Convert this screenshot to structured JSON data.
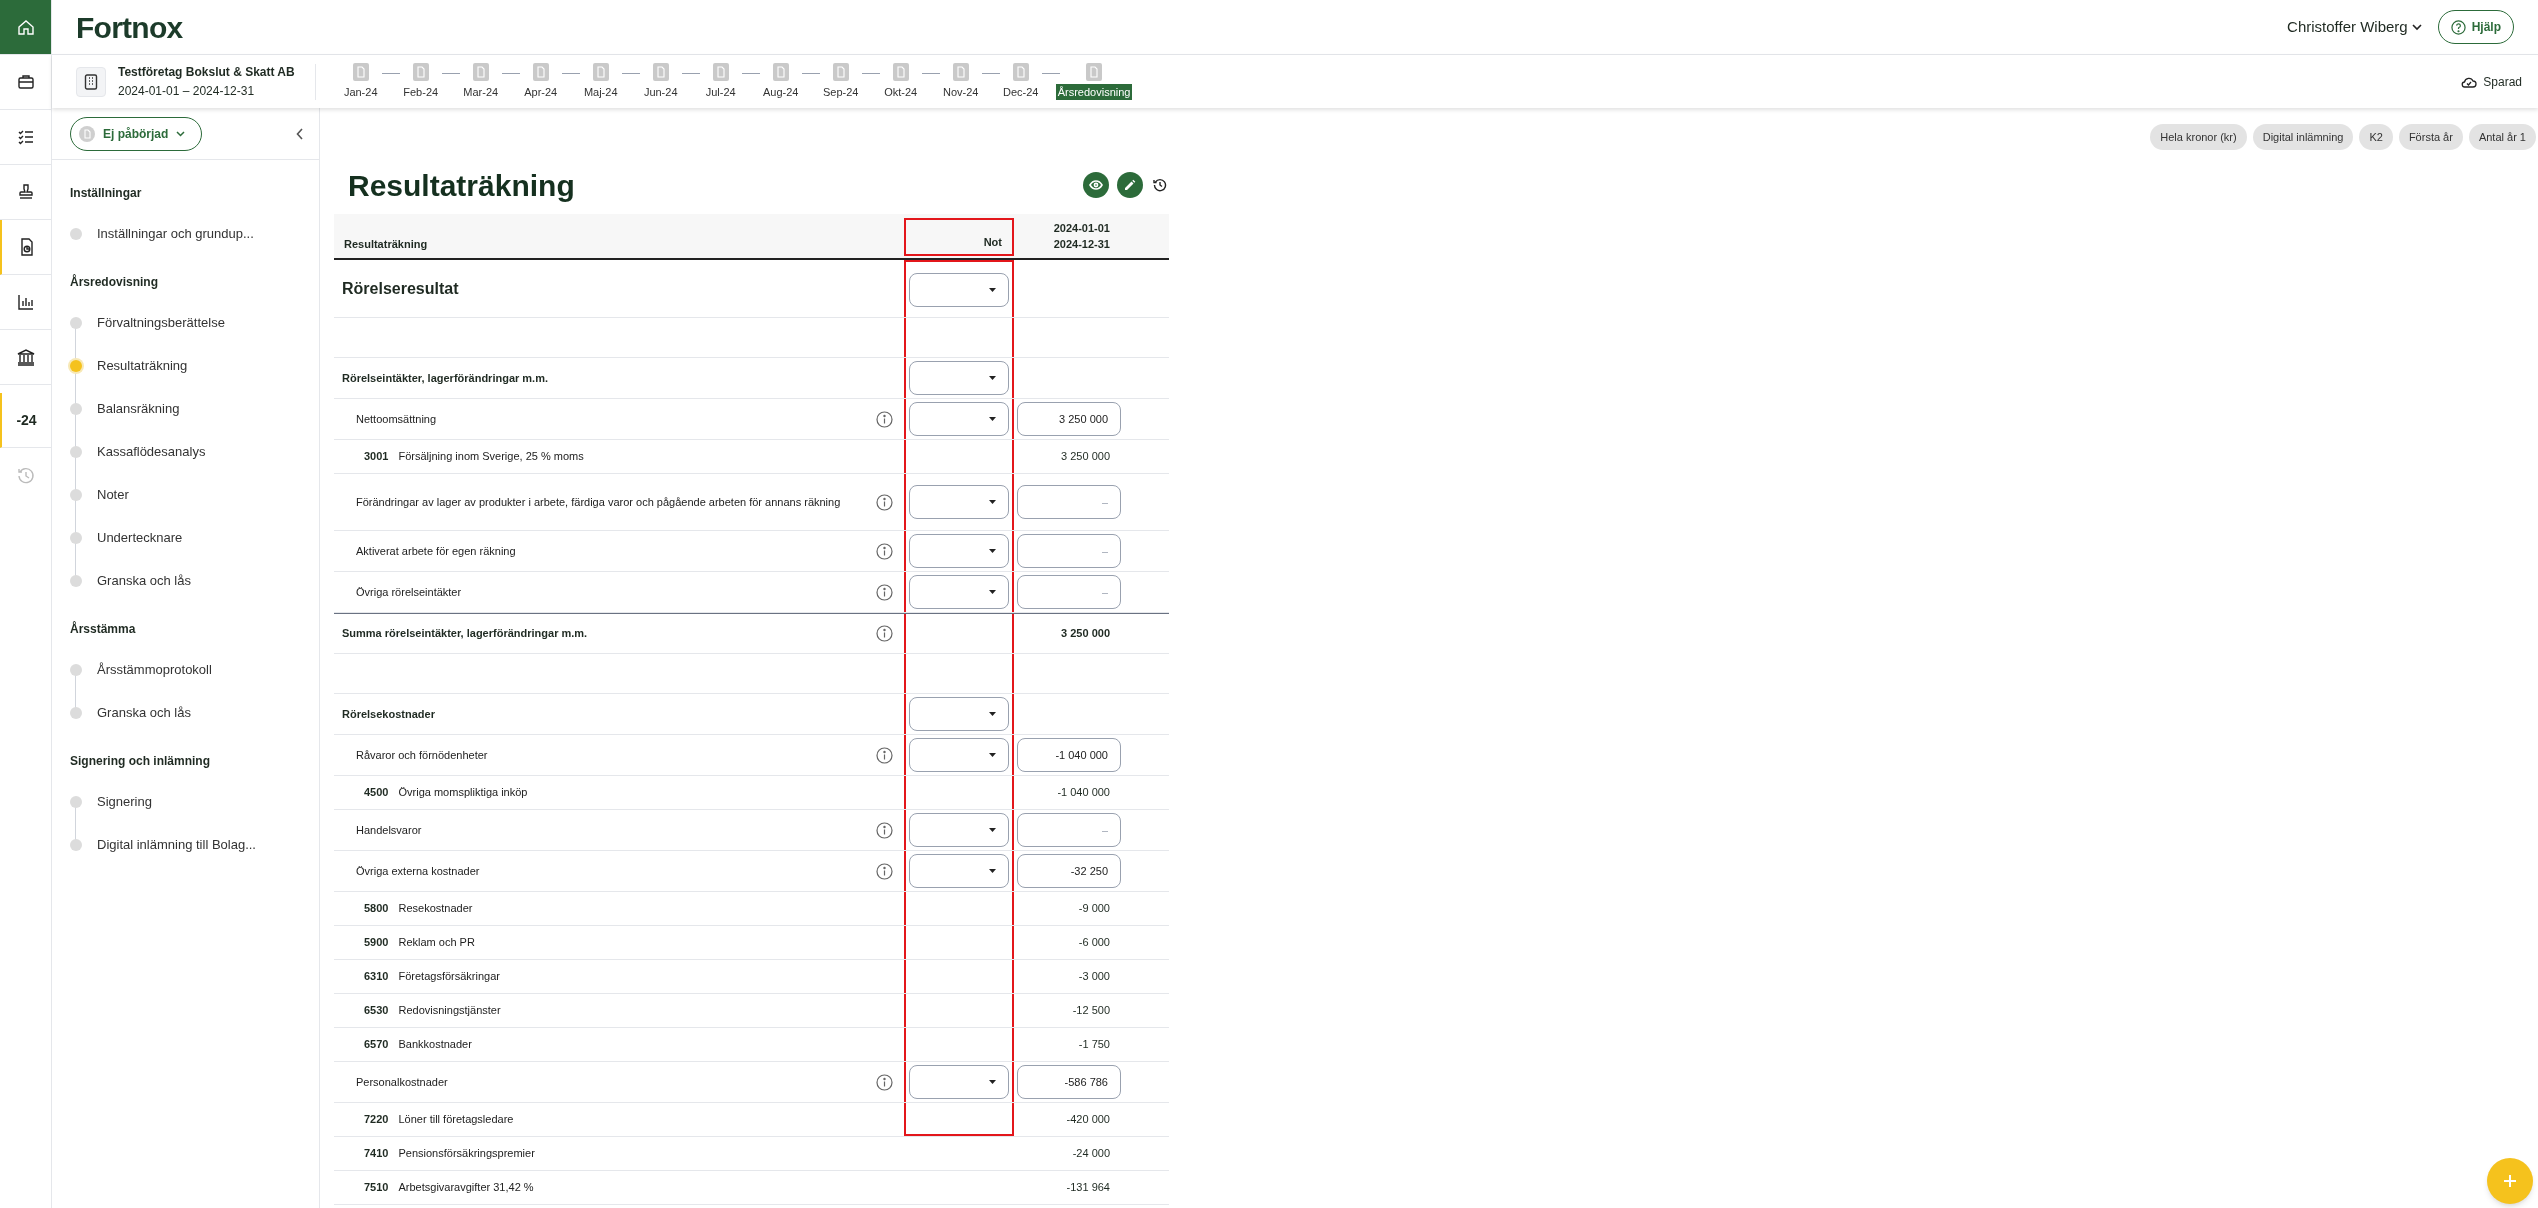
{
  "app": {
    "logo": "Fortnox",
    "user": "Christoffer Wiberg",
    "help_button": "Hjälp"
  },
  "rail": [
    {
      "kind": "home",
      "selected": true,
      "flagged": false
    },
    {
      "kind": "briefcase",
      "selected": false,
      "flagged": false
    },
    {
      "kind": "checklist",
      "selected": false,
      "flagged": false
    },
    {
      "kind": "stamp",
      "selected": false,
      "flagged": false
    },
    {
      "kind": "document",
      "selected": false,
      "flagged": true
    },
    {
      "kind": "chart",
      "selected": false,
      "flagged": false
    },
    {
      "kind": "bank",
      "selected": false,
      "flagged": false
    },
    {
      "kind": "text",
      "label": "-24",
      "selected": false,
      "flagged": true
    },
    {
      "kind": "history",
      "selected": false,
      "flagged": false
    }
  ],
  "company": {
    "name": "Testföretag Bokslut & Skatt AB",
    "period": "2024-01-01 – 2024-12-31"
  },
  "timeline": [
    {
      "label": "Jan-24",
      "selected": false
    },
    {
      "label": "Feb-24",
      "selected": false
    },
    {
      "label": "Mar-24",
      "selected": false
    },
    {
      "label": "Apr-24",
      "selected": false
    },
    {
      "label": "Maj-24",
      "selected": false
    },
    {
      "label": "Jun-24",
      "selected": false
    },
    {
      "label": "Jul-24",
      "selected": false
    },
    {
      "label": "Aug-24",
      "selected": false
    },
    {
      "label": "Sep-24",
      "selected": false
    },
    {
      "label": "Okt-24",
      "selected": false
    },
    {
      "label": "Nov-24",
      "selected": false
    },
    {
      "label": "Dec-24",
      "selected": false
    },
    {
      "label": "Årsredovisning",
      "selected": true
    }
  ],
  "save_status": "Sparad",
  "sidebar": {
    "status_button": "Ej påbörjad",
    "sections": [
      {
        "title": "Inställningar",
        "items": [
          {
            "label": "Inställningar och grundup...",
            "selected": false
          }
        ]
      },
      {
        "title": "Årsredovisning",
        "items": [
          {
            "label": "Förvaltningsberättelse",
            "selected": false
          },
          {
            "label": "Resultaträkning",
            "selected": true
          },
          {
            "label": "Balansräkning",
            "selected": false
          },
          {
            "label": "Kassaflödesanalys",
            "selected": false
          },
          {
            "label": "Noter",
            "selected": false
          },
          {
            "label": "Undertecknare",
            "selected": false
          },
          {
            "label": "Granska och lås",
            "selected": false
          }
        ]
      },
      {
        "title": "Årsstämma",
        "items": [
          {
            "label": "Årsstämmoprotokoll",
            "selected": false
          },
          {
            "label": "Granska och lås",
            "selected": false
          }
        ]
      },
      {
        "title": "Signering och inlämning",
        "items": [
          {
            "label": "Signering",
            "selected": false
          },
          {
            "label": "Digital inlämning till Bolag...",
            "selected": false
          }
        ]
      }
    ]
  },
  "chips": [
    "Hela kronor (kr)",
    "Digital inlämning",
    "K2",
    "Första år",
    "Antal år 1"
  ],
  "page_title": "Resultaträkning",
  "table": {
    "header": {
      "label": "Resultaträkning",
      "note": "Not",
      "note_highlighted": true,
      "period_start": "2024-01-01",
      "period_end": "2024-12-31"
    },
    "rows": [
      {
        "kind": "section",
        "label": "Rörelseresultat",
        "highlighted": true
      },
      {
        "kind": "spacer",
        "highlighted": true
      },
      {
        "kind": "group",
        "label": "Rörelseintäkter, lagerförändringar m.m.",
        "highlighted": true
      },
      {
        "kind": "line",
        "label": "Nettoomsättning",
        "value": "3 250 000",
        "highlighted": true
      },
      {
        "kind": "account",
        "number": "3001",
        "label": "Försäljning inom Sverige, 25 % moms",
        "value": "3 250 000",
        "highlighted": true
      },
      {
        "kind": "line",
        "label": "Förändringar av lager av produkter i arbete, färdiga varor och pågående arbeten för annans räkning",
        "placeholder": "–",
        "highlighted": true
      },
      {
        "kind": "line",
        "label": "Aktiverat arbete för egen räkning",
        "placeholder": "–",
        "highlighted": true
      },
      {
        "kind": "line",
        "label": "Övriga rörelseintäkter",
        "placeholder": "–",
        "highlighted": true
      },
      {
        "kind": "sum",
        "label": "Summa rörelseintäkter, lagerförändringar m.m.",
        "value": "3 250 000",
        "highlighted": true
      },
      {
        "kind": "spacer",
        "highlighted": true
      },
      {
        "kind": "group",
        "label": "Rörelsekostnader",
        "highlighted": true
      },
      {
        "kind": "line",
        "label": "Råvaror och förnödenheter",
        "value": "-1 040 000",
        "highlighted": true
      },
      {
        "kind": "account",
        "number": "4500",
        "label": "Övriga momspliktiga inköp",
        "value": "-1 040 000",
        "highlighted": true
      },
      {
        "kind": "line",
        "label": "Handelsvaror",
        "placeholder": "–",
        "highlighted": true
      },
      {
        "kind": "line",
        "label": "Övriga externa kostnader",
        "value": "-32 250",
        "highlighted": true
      },
      {
        "kind": "account",
        "number": "5800",
        "label": "Resekostnader",
        "value": "-9 000",
        "highlighted": true
      },
      {
        "kind": "account",
        "number": "5900",
        "label": "Reklam och PR",
        "value": "-6 000",
        "highlighted": true
      },
      {
        "kind": "account",
        "number": "6310",
        "label": "Företagsförsäkringar",
        "value": "-3 000",
        "highlighted": true
      },
      {
        "kind": "account",
        "number": "6530",
        "label": "Redovisningstjänster",
        "value": "-12 500",
        "highlighted": true
      },
      {
        "kind": "account",
        "number": "6570",
        "label": "Bankkostnader",
        "value": "-1 750",
        "highlighted": true
      },
      {
        "kind": "line",
        "label": "Personalkostnader",
        "value": "-586 786",
        "highlighted": true
      },
      {
        "kind": "account",
        "number": "7220",
        "label": "Löner till företagsledare",
        "value": "-420 000",
        "highlighted": true
      },
      {
        "kind": "account",
        "number": "7410",
        "label": "Pensionsförsäkringspremier",
        "value": "-24 000",
        "highlighted": false
      },
      {
        "kind": "account",
        "number": "7510",
        "label": "Arbetsgivaravgifter 31,42 %",
        "value": "-131 964",
        "highlighted": false
      }
    ]
  }
}
